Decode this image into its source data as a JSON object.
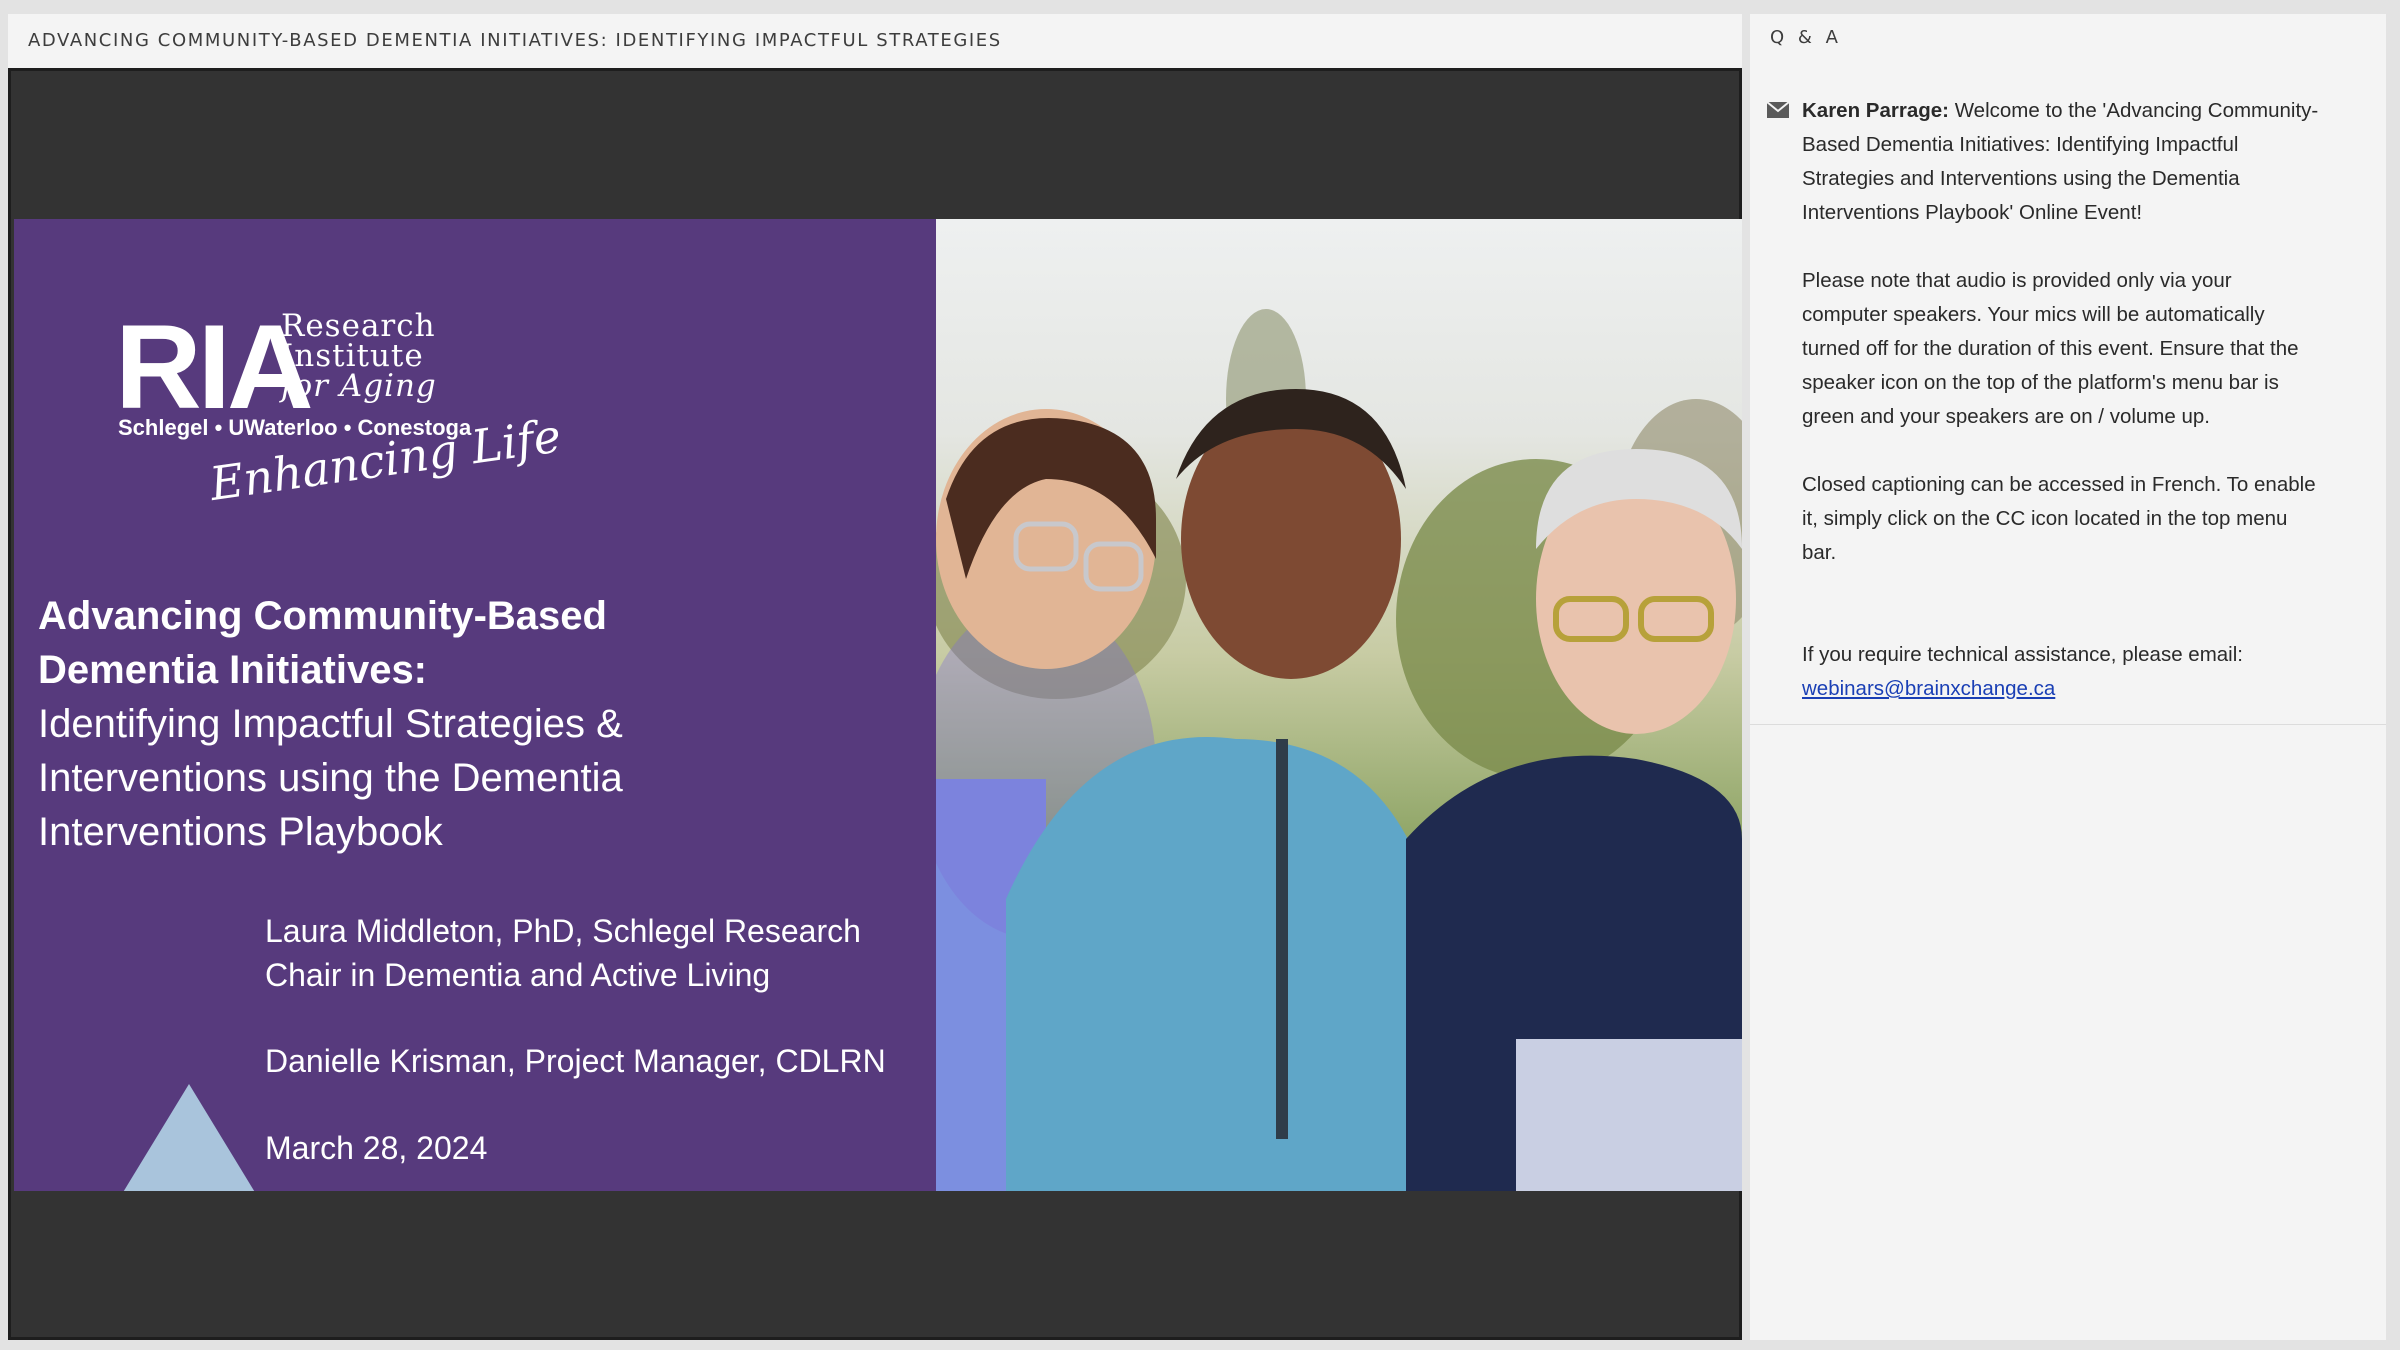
{
  "pod": {
    "title": "ADVANCING COMMUNITY-BASED DEMENTIA INITIATIVES: IDENTIFYING IMPACTFUL STRATEGIES"
  },
  "slide": {
    "logo": {
      "acronym": "RIA",
      "word1": "Research",
      "word2": "Institute",
      "word3": "for Aging",
      "partners": "Schlegel • UWaterloo • Conestoga",
      "tagline": "Enhancing Life"
    },
    "heading_line1": "Advancing Community-Based",
    "heading_line2": "Dementia Initiatives:",
    "subheading_line1": "Identifying Impactful Strategies &",
    "subheading_line2": "Interventions using the Dementia",
    "subheading_line3": "Interventions Playbook",
    "presenter1_line1": "Laura Middleton, PhD, Schlegel Research",
    "presenter1_line2": "Chair in Dementia and Active Living",
    "presenter2": "Danielle Krisman, Project Manager, CDLRN",
    "date": "March 28, 2024"
  },
  "qa": {
    "title": "Q & A",
    "messages": [
      {
        "author": "Karen Parrage:",
        "paragraph1": "Welcome to the 'Advancing Community-Based Dementia Initiatives: Identifying Impactful Strategies and Interventions using the Dementia Interventions Playbook' Online Event!",
        "paragraph2": "Please note that audio is provided only via your computer speakers. Your mics will be automatically turned off for the duration of this event. Ensure that the speaker icon on the top of the platform's menu bar is green and your speakers are on / volume up.",
        "paragraph3": "Closed captioning can be accessed in French. To enable it, simply click on the CC icon located in the top menu bar.",
        "paragraph4": "If you require technical assistance, please email:",
        "email": "webinars@brainxchange.ca"
      }
    ]
  },
  "colors": {
    "slide_purple": "#573a7d",
    "stage_dark": "#333333",
    "link": "#1a3fb5",
    "triangle": "#a9c4dc"
  },
  "icons": [
    "mail-icon"
  ]
}
